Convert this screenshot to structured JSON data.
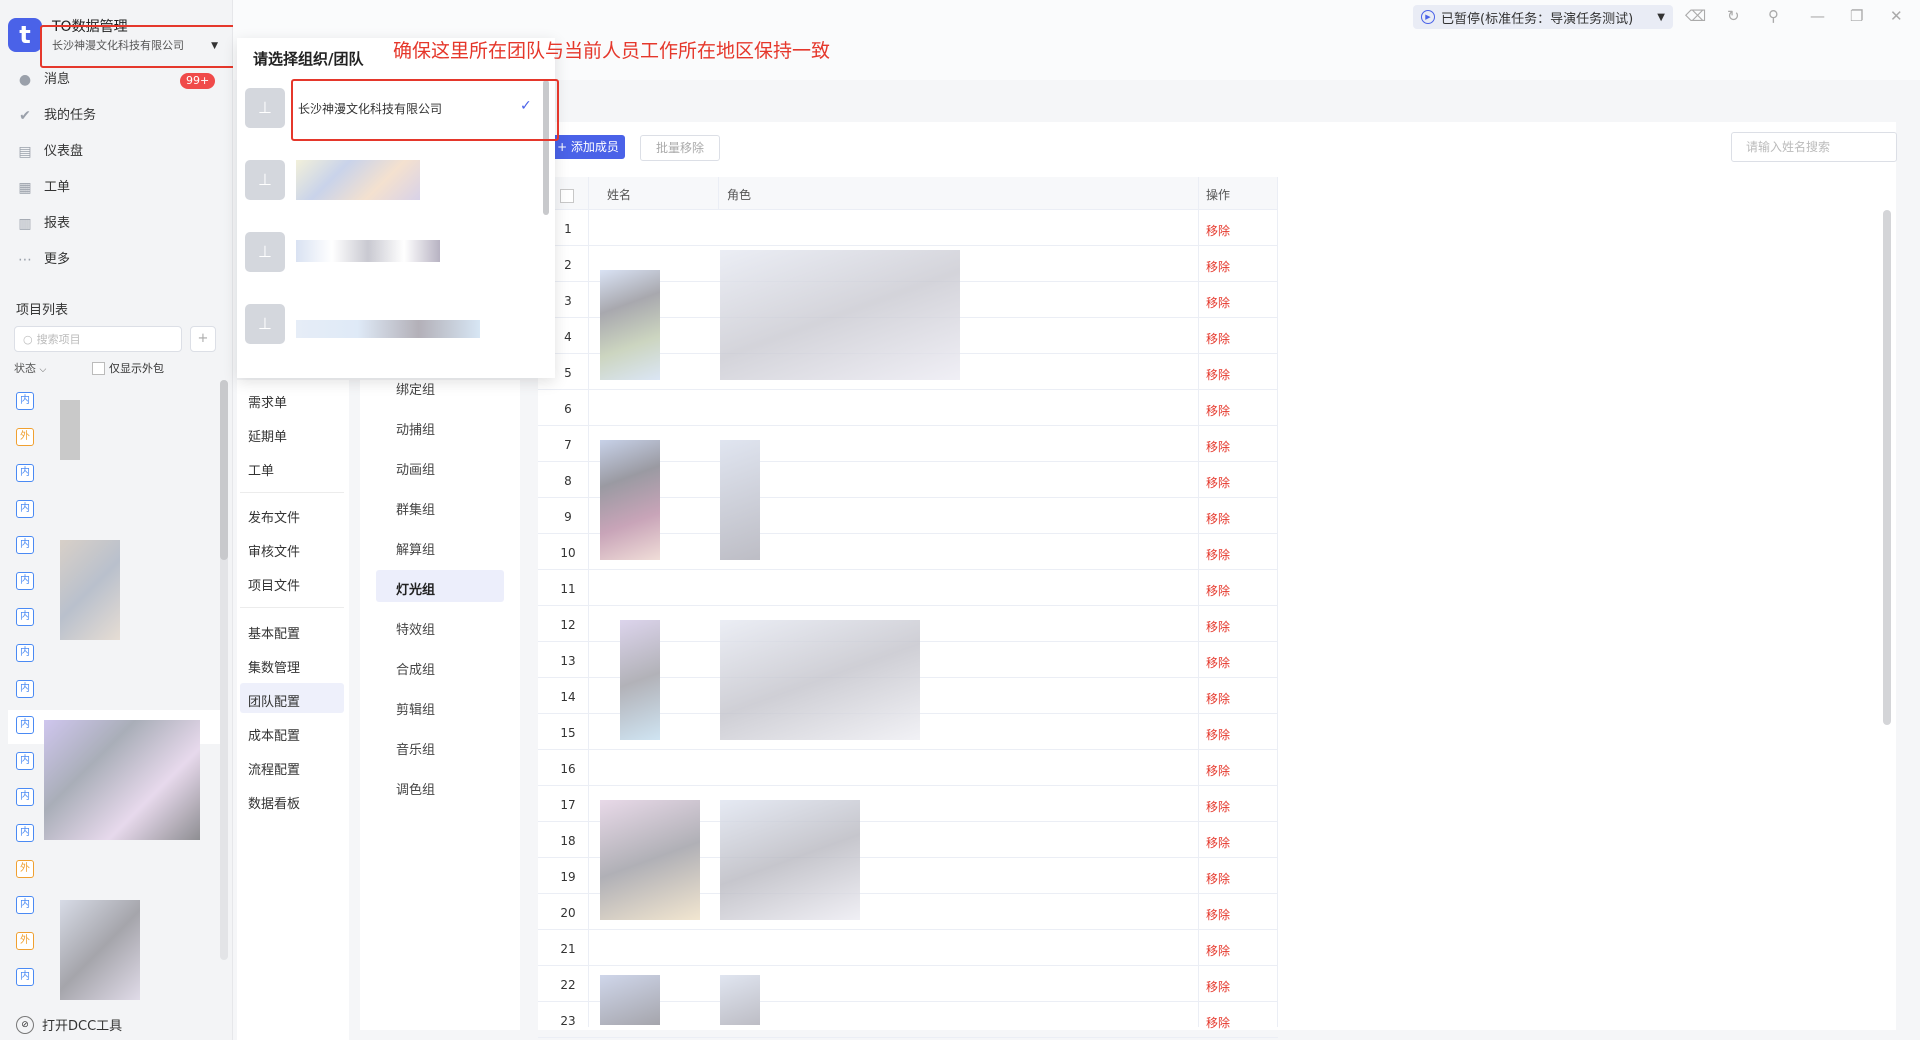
{
  "app": {
    "logo_letter": "t",
    "title": "TO数据管理",
    "org": "长沙神漫文化科技有限公司"
  },
  "nav": [
    {
      "label": "消息",
      "icon": "message-icon"
    },
    {
      "label": "我的任务",
      "icon": "check-icon"
    },
    {
      "label": "仪表盘",
      "icon": "dashboard-icon"
    },
    {
      "label": "工单",
      "icon": "ticket-icon"
    },
    {
      "label": "报表",
      "icon": "report-icon"
    },
    {
      "label": "更多",
      "icon": "more-icon"
    }
  ],
  "badge": "99+",
  "projects": {
    "title": "项目列表",
    "search_placeholder": "搜索项目",
    "status_label": "状态",
    "outsource_label": "仅显示外包",
    "tags": [
      "内",
      "外",
      "内",
      "内",
      "内",
      "内",
      "内",
      "内",
      "内",
      "内",
      "内",
      "内",
      "内",
      "外",
      "内",
      "外",
      "内"
    ]
  },
  "dcc_label": "打开DCC工具",
  "task": {
    "label": "已暂停(标准任务：导演任务测试)"
  },
  "annotation": "确保这里所在团队与当前人员工作所在地区保持一致",
  "dropdown": {
    "title": "请选择组织/团队",
    "first_item": "长沙神漫文化科技有限公司"
  },
  "menu": [
    "需求单",
    "延期单",
    "工单",
    "发布文件",
    "审核文件",
    "项目文件",
    "基本配置",
    "集数管理",
    "团队配置",
    "成本配置",
    "流程配置",
    "数据看板"
  ],
  "groups": [
    "绑定组",
    "动捕组",
    "动画组",
    "群集组",
    "解算组",
    "灯光组",
    "特效组",
    "合成组",
    "剪辑组",
    "音乐组",
    "调色组"
  ],
  "toolbar": {
    "add": "+ 添加成员",
    "bulk_remove": "批量移除",
    "search_placeholder": "请输入姓名搜索"
  },
  "table": {
    "headers": {
      "name": "姓名",
      "role": "角色",
      "action": "操作"
    },
    "rows": [
      "1",
      "2",
      "3",
      "4",
      "5",
      "6",
      "7",
      "8",
      "9",
      "10",
      "11",
      "12",
      "13",
      "14",
      "15",
      "16",
      "17",
      "18",
      "19",
      "20",
      "21",
      "22",
      "23"
    ],
    "action_label": "移除"
  }
}
